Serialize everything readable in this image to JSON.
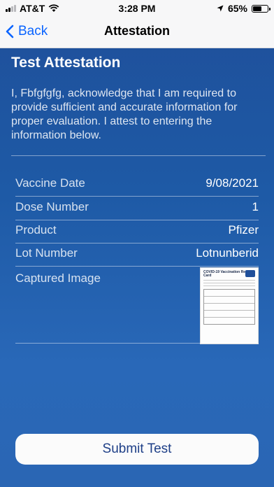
{
  "status_bar": {
    "carrier": "AT&T",
    "time": "3:28 PM",
    "battery": "65%",
    "battery_level": 0.65
  },
  "nav": {
    "back_label": "Back",
    "title": "Attestation"
  },
  "attestation": {
    "heading": "Test Attestation",
    "statement": "I, Fbfgfgfg, acknowledge that I am required to provide sufficient and accurate information for proper evaluation. I attest to entering the information below."
  },
  "fields": [
    {
      "label": "Vaccine Date",
      "value": "9/08/2021"
    },
    {
      "label": "Dose Number",
      "value": "1"
    },
    {
      "label": "Product",
      "value": "Pfizer"
    },
    {
      "label": "Lot Number",
      "value": "Lotnunberid"
    },
    {
      "label": "Captured Image",
      "value": ""
    }
  ],
  "card_image": {
    "title": "COVID-19 Vaccination Record Card"
  },
  "submit_label": "Submit Test",
  "colors": {
    "accent": "#0a64ff",
    "background": "#1f57a3",
    "button_text": "#1e3f87"
  }
}
